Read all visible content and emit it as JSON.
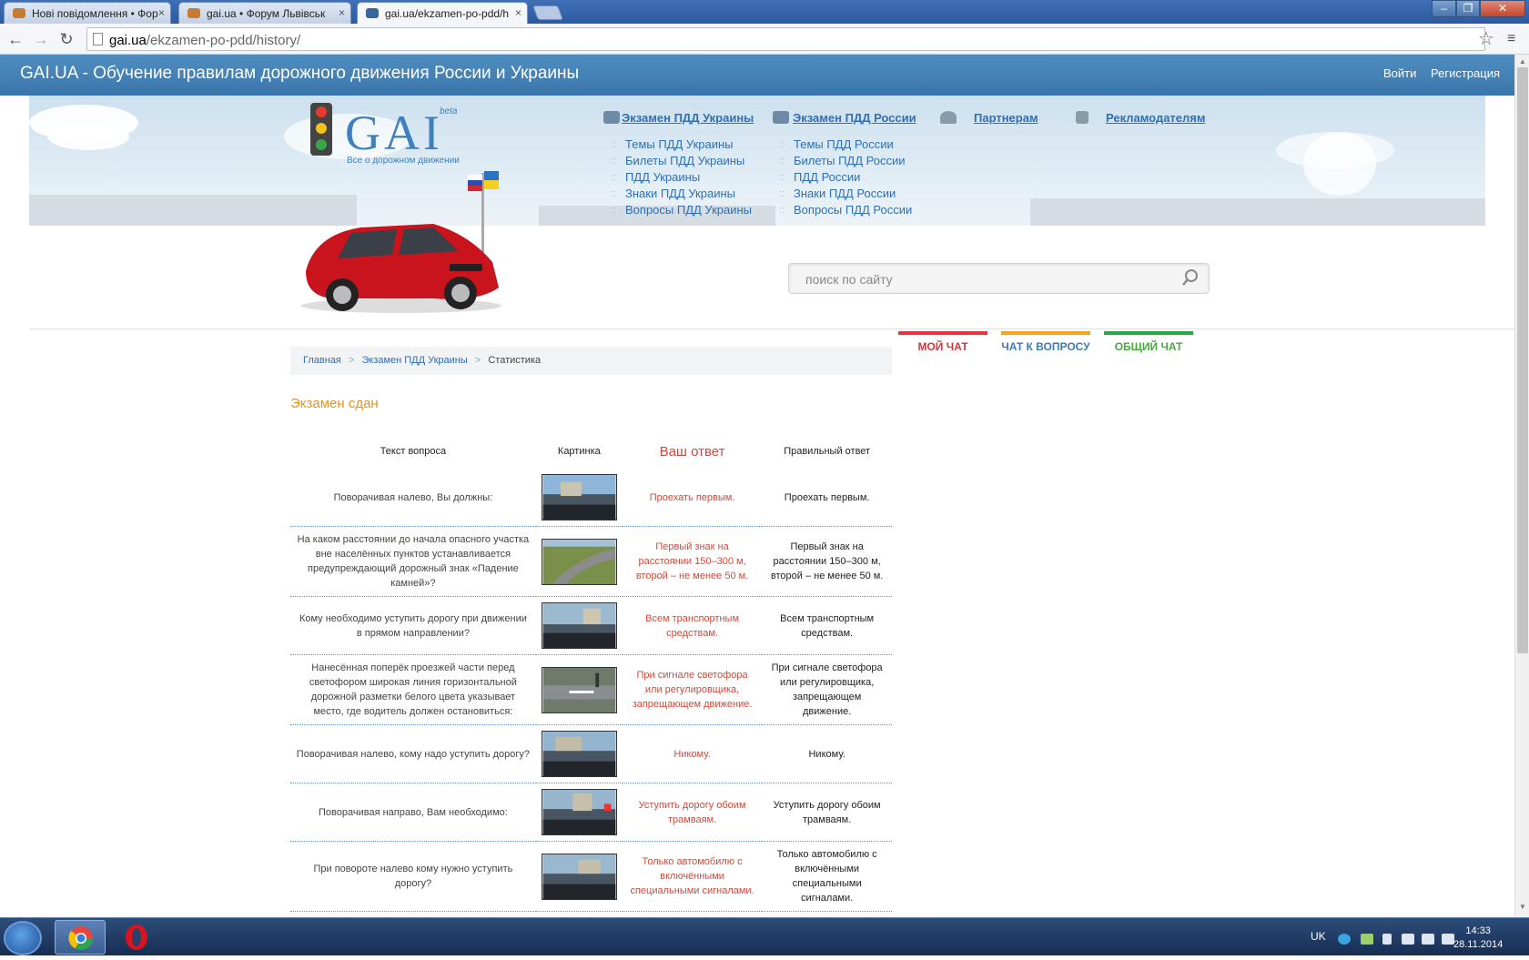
{
  "browser": {
    "tabs": [
      {
        "label": "Нові повідомлення • Фор",
        "active": false
      },
      {
        "label": "gai.ua • Форум Львівськ",
        "active": false
      },
      {
        "label": "gai.ua/ekzamen-po-pdd/h",
        "active": true
      }
    ],
    "close_glyph": "×",
    "url_domain": "gai.ua",
    "url_path": "/ekzamen-po-pdd/history/",
    "win_minimize": "–",
    "win_maximize": "❐",
    "win_close": "✕",
    "back_glyph": "←",
    "forward_glyph": "→",
    "reload_glyph": "↻",
    "star_glyph": "☆",
    "menu_glyph": "≡"
  },
  "site": {
    "title": "GAI.UA - Обучение правилам дорожного движения России и Украины",
    "login": "Войти",
    "register": "Регистрация",
    "logo_text": "GAI",
    "logo_beta": "beta",
    "logo_slogan": "Все о дорожном движении",
    "nav": {
      "ukraine_head": "Экзамен ПДД Украины",
      "ukraine_items": [
        "Темы ПДД Украины",
        "Билеты ПДД Украины",
        "ПДД Украины",
        "Знаки ПДД Украины",
        "Вопросы ПДД Украины"
      ],
      "russia_head": "Экзамен ПДД России",
      "russia_items": [
        "Темы ПДД России",
        "Билеты ПДД России",
        "ПДД России",
        "Знаки ПДД России",
        "Вопросы ПДД России"
      ],
      "partners": "Партнерам",
      "advertisers": "Рекламодателям"
    },
    "search_placeholder": "поиск по сайту",
    "chats": [
      {
        "label": "МОЙ ЧАТ",
        "color": "#e8323c"
      },
      {
        "label": "ЧАТ К ВОПРОСУ",
        "color": "#f3a41c"
      },
      {
        "label": "ОБЩИЙ ЧАТ",
        "color": "#2aa845"
      }
    ],
    "breadcrumb": {
      "home": "Главная",
      "section": "Экзамен ПДД Украины",
      "current": "Статистика",
      "sep": ">"
    },
    "result": "Экзамен сдан",
    "table": {
      "headers": {
        "question": "Текст вопроса",
        "picture": "Картинка",
        "your_answer": "Ваш ответ",
        "correct": "Правильный ответ"
      },
      "rows": [
        {
          "question": "Поворачивая налево, Вы должны:",
          "your": "Проехать первым.",
          "correct": "Проехать первым."
        },
        {
          "question": "На каком расстоянии до начала опасного участка вне населённых пунктов устанавливается предупреждающий дорожный знак «Падение камней»?",
          "your": "Первый знак на расстоянии 150–300 м, второй – не менее 50 м.",
          "correct": "Первый знак на расстоянии 150–300 м, второй – не менее 50 м."
        },
        {
          "question": "Кому необходимо уступить дорогу при движении в прямом направлении?",
          "your": "Всем транспортным средствам.",
          "correct": "Всем транспортным средствам."
        },
        {
          "question": "Нанесённая поперёк проезжей части перед светофором широкая линия горизонтальной дорожной разметки белого цвета указывает место, где водитель должен остановиться:",
          "your": "При сигнале светофора или регулировщика, запрещающем движение.",
          "correct": "При сигнале светофора или регулировщика, запрещающем движение."
        },
        {
          "question": "Поворачивая налево, кому надо уступить дорогу?",
          "your": "Никому.",
          "correct": "Никому."
        },
        {
          "question": "Поворачивая направо, Вам необходимо:",
          "your": "Уступить дорогу обоим трамваям.",
          "correct": "Уступить дорогу обоим трамваям."
        },
        {
          "question": "При повороте налево кому нужно уступить дорогу?",
          "your": "Только автомобилю с включёнными специальными сигналами.",
          "correct": "Только автомобилю с включёнными специальными сигналами."
        }
      ]
    }
  },
  "taskbar": {
    "lang": "UK",
    "time": "14:33",
    "date": "28.11.2014"
  }
}
